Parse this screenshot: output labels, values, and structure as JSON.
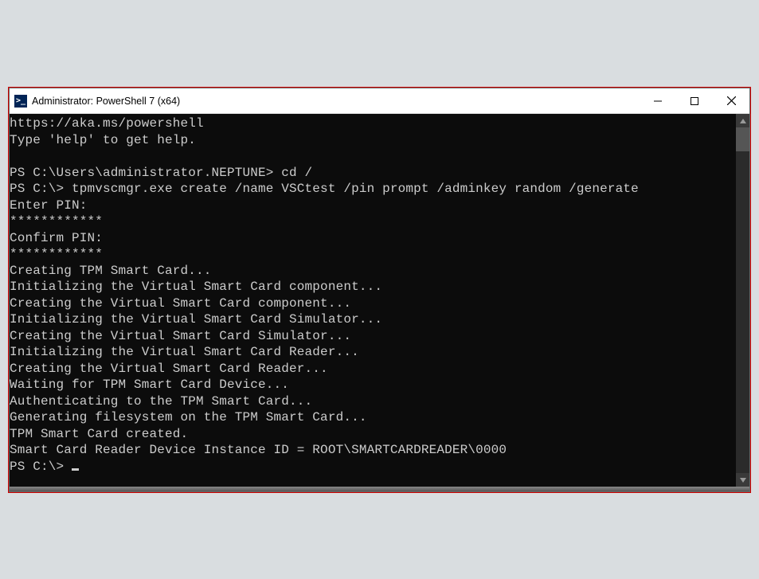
{
  "window": {
    "title": "Administrator: PowerShell 7 (x64)",
    "icon_glyph": ">_"
  },
  "terminal": {
    "lines": [
      "https://aka.ms/powershell",
      "Type 'help' to get help.",
      "",
      "PS C:\\Users\\administrator.NEPTUNE> cd /",
      "PS C:\\> tpmvscmgr.exe create /name VSCtest /pin prompt /adminkey random /generate",
      "Enter PIN:",
      "************",
      "Confirm PIN:",
      "************",
      "Creating TPM Smart Card...",
      "Initializing the Virtual Smart Card component...",
      "Creating the Virtual Smart Card component...",
      "Initializing the Virtual Smart Card Simulator...",
      "Creating the Virtual Smart Card Simulator...",
      "Initializing the Virtual Smart Card Reader...",
      "Creating the Virtual Smart Card Reader...",
      "Waiting for TPM Smart Card Device...",
      "Authenticating to the TPM Smart Card...",
      "Generating filesystem on the TPM Smart Card...",
      "TPM Smart Card created.",
      "Smart Card Reader Device Instance ID = ROOT\\SMARTCARDREADER\\0000",
      "PS C:\\> "
    ]
  }
}
